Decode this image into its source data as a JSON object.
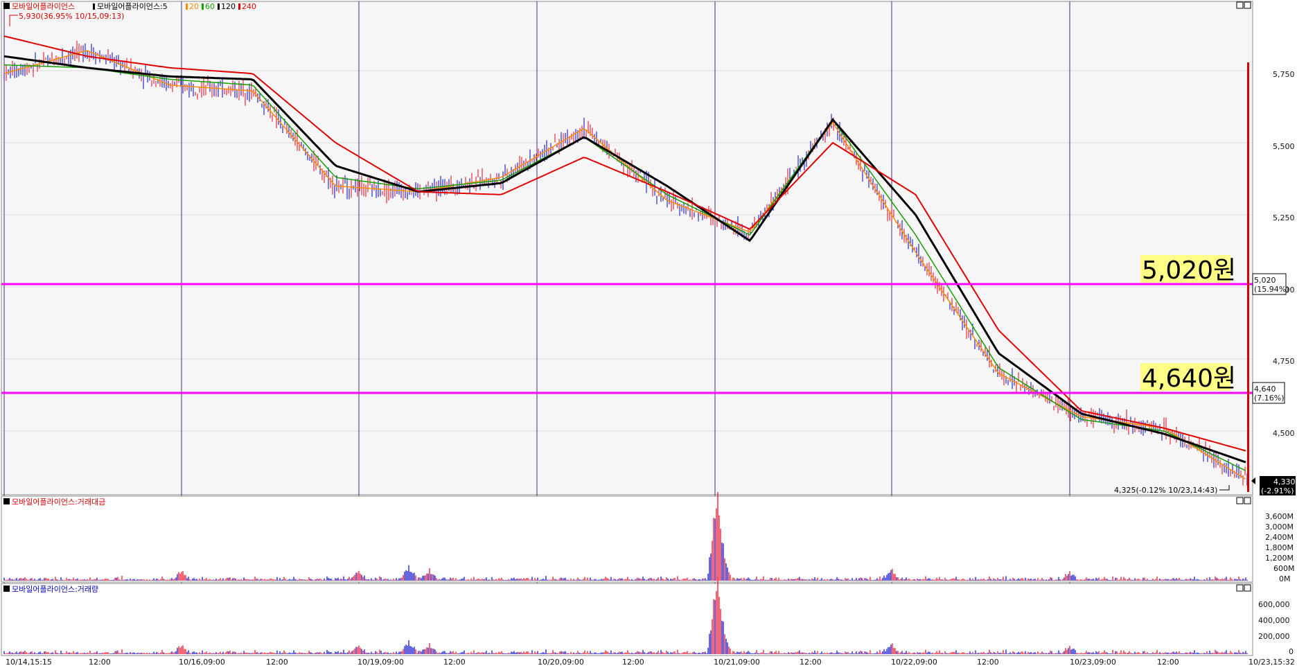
{
  "colors": {
    "panel_bg": "#f6f6f6",
    "grid": "#dcdcdc",
    "vline": "#4b2a7a",
    "hline": "#ff00ff",
    "up": "#e8001c",
    "down": "#0000c8",
    "ma5": "#ff8c00",
    "ma20": "#13a000",
    "ma60": "#000000",
    "ma240": "#e00000",
    "label_bg": "#ffff88"
  },
  "price_panel": {
    "legend": {
      "name": "모바일어플라이언스",
      "ma_prefix": "모바일어플라이언스:5",
      "ma20": "20",
      "ma60": "60",
      "ma120": "120",
      "ma240": "240"
    },
    "high_note": "5,930(36.95% 10/15,09:13)",
    "low_note": "4,325(-0.12% 10/23,14:43)",
    "y_ticks": [
      "5,750",
      "5,500",
      "5,250",
      "5,000",
      "4,750",
      "4,500"
    ],
    "level_5020": {
      "label": "5,020원",
      "price": "5,020",
      "pct": "(15.94%)"
    },
    "level_4640": {
      "label": "4,640원",
      "price": "4,640",
      "pct": "(7.16%)"
    },
    "current": {
      "price": "4,330",
      "pct": "(-2.91%)"
    }
  },
  "amount_panel": {
    "title": "모바일어플라이언스:거래대금",
    "y_ticks": [
      "3,600M",
      "3,000M",
      "2,400M",
      "1,800M",
      "1,200M",
      "600M",
      "0M"
    ]
  },
  "volume_panel": {
    "title": "모바일어플라이언스:거래량",
    "y_ticks": [
      "600,000",
      "400,000",
      "200,000",
      "0"
    ]
  },
  "x_labels": [
    "10/14,15:15",
    "12:00",
    "10/16,09:00",
    "12:00",
    "10/19,09:00",
    "12:00",
    "10/20,09:00",
    "12:00",
    "10/21,09:00",
    "12:00",
    "10/22,09:00",
    "12:00",
    "10/23,09:00",
    "12:00",
    "10/23,15:32"
  ],
  "chart_data": {
    "type": "line",
    "title": "모바일어플라이언스",
    "x": [
      "10/14 15:15",
      "10/15 09:00",
      "10/15 12:00",
      "10/16 09:00",
      "10/16 12:00",
      "10/19 09:00",
      "10/19 12:00",
      "10/20 09:00",
      "10/20 12:00",
      "10/21 09:00",
      "10/21 12:00",
      "10/22 09:00",
      "10/22 12:00",
      "10/23 09:00",
      "10/23 12:00",
      "10/23 15:32"
    ],
    "series": [
      {
        "name": "5",
        "values": [
          5740,
          5820,
          5700,
          5680,
          5350,
          5330,
          5380,
          5550,
          5300,
          5190,
          5570,
          5120,
          4700,
          4550,
          4510,
          4330
        ]
      },
      {
        "name": "20",
        "values": [
          5770,
          5760,
          5720,
          5700,
          5380,
          5340,
          5370,
          5520,
          5320,
          5180,
          5580,
          5180,
          4720,
          4540,
          4500,
          4360
        ]
      },
      {
        "name": "60",
        "values": [
          5800,
          5760,
          5730,
          5720,
          5420,
          5330,
          5360,
          5520,
          5350,
          5160,
          5580,
          5250,
          4770,
          4560,
          4490,
          4390
        ]
      },
      {
        "name": "240",
        "values": [
          5870,
          5800,
          5760,
          5740,
          5500,
          5330,
          5320,
          5450,
          5330,
          5200,
          5500,
          5320,
          4850,
          4570,
          4510,
          4430
        ]
      }
    ],
    "levels": [
      5020,
      4640
    ],
    "high": {
      "value": 5930,
      "time": "10/15,09:13"
    },
    "low": {
      "value": 4325,
      "time": "10/23,14:43"
    },
    "last": 4330,
    "ylim": [
      4250,
      6000
    ]
  }
}
